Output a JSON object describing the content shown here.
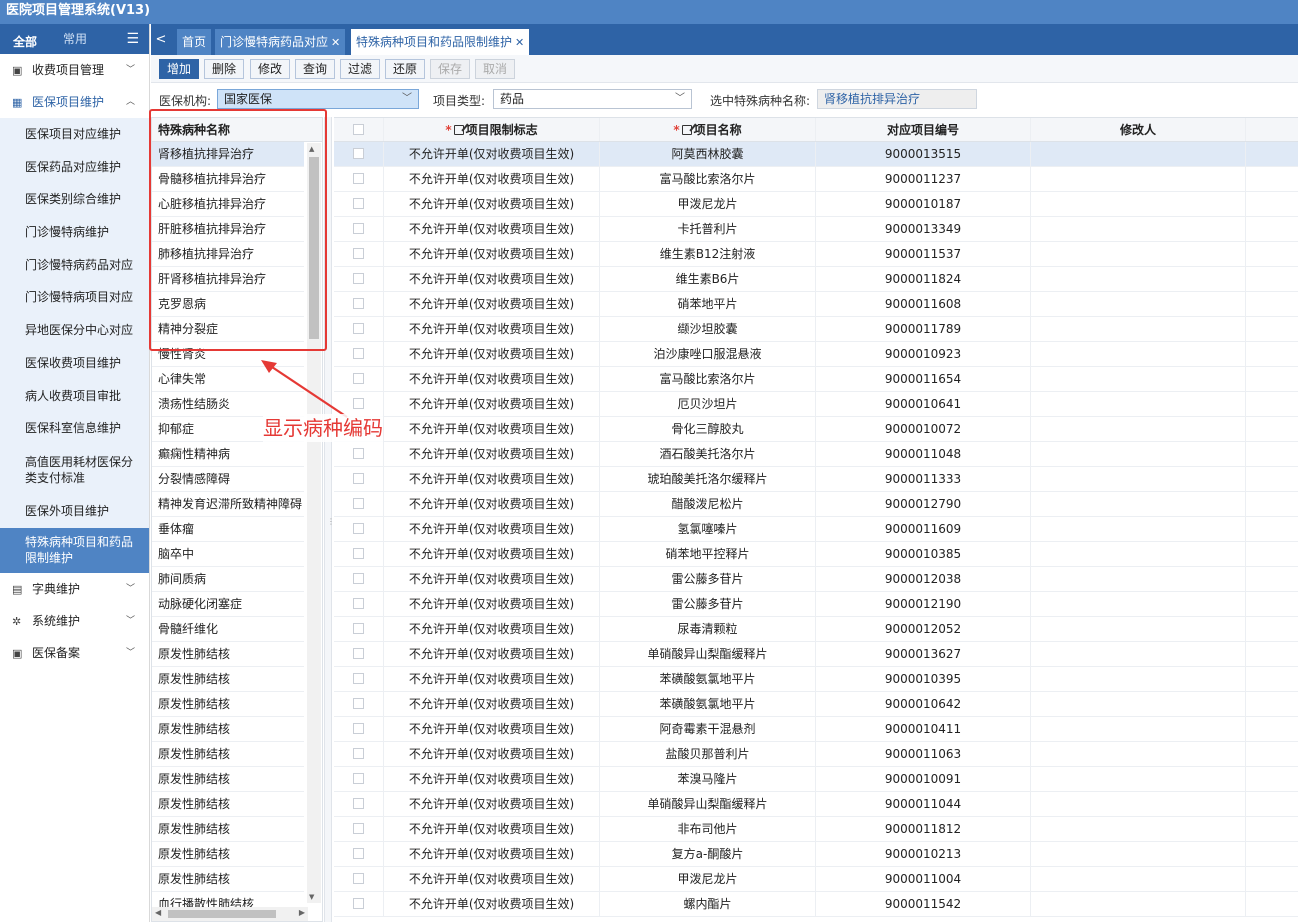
{
  "app": {
    "title": "医院项目管理系统(V13)"
  },
  "nav": {
    "tabs": [
      "全部",
      "常用"
    ],
    "groups": [
      {
        "label": "收费项目管理",
        "icon": "calendar-icon",
        "open": false
      },
      {
        "label": "医保项目维护",
        "icon": "grid-icon",
        "open": true,
        "items": [
          "医保项目对应维护",
          "医保药品对应维护",
          "医保类别综合维护",
          "门诊慢特病维护",
          "门诊慢特病药品对应",
          "门诊慢特病项目对应",
          "异地医保分中心对应",
          "医保收费项目维护",
          "病人收费项目审批",
          "医保科室信息维护",
          "高值医用耗材医保分类支付标准",
          "医保外项目维护",
          "特殊病种项目和药品限制维护"
        ]
      },
      {
        "label": "字典维护",
        "icon": "book-icon",
        "open": false
      },
      {
        "label": "系统维护",
        "icon": "gear-icon",
        "open": false
      },
      {
        "label": "医保备案",
        "icon": "folder-icon",
        "open": false
      }
    ]
  },
  "page_tabs": [
    {
      "label": "首页",
      "closable": false
    },
    {
      "label": "门诊慢特病药品对应",
      "closable": true
    },
    {
      "label": "特殊病种项目和药品限制维护",
      "closable": true
    }
  ],
  "toolbar": {
    "buttons": [
      "增加",
      "删除",
      "修改",
      "查询",
      "过滤",
      "还原",
      "保存",
      "取消"
    ]
  },
  "filters": {
    "org_label": "医保机构:",
    "org_value": "国家医保",
    "type_label": "项目类型:",
    "type_value": "药品",
    "selected_label": "选中特殊病种名称:",
    "selected_value": "肾移植抗排异治疗"
  },
  "disease_list": {
    "header": "特殊病种名称",
    "rows": [
      "肾移植抗排异治疗",
      "骨髓移植抗排异治疗",
      "心脏移植抗排异治疗",
      "肝脏移植抗排异治疗",
      "肺移植抗排异治疗",
      "肝肾移植抗排异治疗",
      "克罗恩病",
      "精神分裂症",
      "慢性肾炎",
      "心律失常",
      "溃疡性结肠炎",
      "抑郁症",
      "癫痫性精神病",
      "分裂情感障碍",
      "精神发育迟滞所致精神障碍",
      "垂体瘤",
      "脑卒中",
      "肺间质病",
      "动脉硬化闭塞症",
      "骨髓纤维化",
      "原发性肺结核",
      "原发性肺结核",
      "原发性肺结核",
      "原发性肺结核",
      "原发性肺结核",
      "原发性肺结核",
      "原发性肺结核",
      "原发性肺结核",
      "原发性肺结核",
      "原发性肺结核",
      "血行播散性肺结核"
    ]
  },
  "grid": {
    "columns": [
      "",
      "项目限制标志",
      "项目名称",
      "对应项目编号",
      "修改人"
    ],
    "rows": [
      [
        "不允许开单(仅对收费项目生效)",
        "阿莫西林胶囊",
        "9000013515"
      ],
      [
        "不允许开单(仅对收费项目生效)",
        "富马酸比索洛尔片",
        "9000011237"
      ],
      [
        "不允许开单(仅对收费项目生效)",
        "甲泼尼龙片",
        "9000010187"
      ],
      [
        "不允许开单(仅对收费项目生效)",
        "卡托普利片",
        "9000013349"
      ],
      [
        "不允许开单(仅对收费项目生效)",
        "维生素B12注射液",
        "9000011537"
      ],
      [
        "不允许开单(仅对收费项目生效)",
        "维生素B6片",
        "9000011824"
      ],
      [
        "不允许开单(仅对收费项目生效)",
        "硝苯地平片",
        "9000011608"
      ],
      [
        "不允许开单(仅对收费项目生效)",
        "缬沙坦胶囊",
        "9000011789"
      ],
      [
        "不允许开单(仅对收费项目生效)",
        "泊沙康唑口服混悬液",
        "9000010923"
      ],
      [
        "不允许开单(仅对收费项目生效)",
        "富马酸比索洛尔片",
        "9000011654"
      ],
      [
        "不允许开单(仅对收费项目生效)",
        "厄贝沙坦片",
        "9000010641"
      ],
      [
        "不允许开单(仅对收费项目生效)",
        "骨化三醇胶丸",
        "9000010072"
      ],
      [
        "不允许开单(仅对收费项目生效)",
        "酒石酸美托洛尔片",
        "9000011048"
      ],
      [
        "不允许开单(仅对收费项目生效)",
        "琥珀酸美托洛尔缓释片",
        "9000011333"
      ],
      [
        "不允许开单(仅对收费项目生效)",
        "醋酸泼尼松片",
        "9000012790"
      ],
      [
        "不允许开单(仅对收费项目生效)",
        "氢氯噻嗪片",
        "9000011609"
      ],
      [
        "不允许开单(仅对收费项目生效)",
        "硝苯地平控释片",
        "9000010385"
      ],
      [
        "不允许开单(仅对收费项目生效)",
        "雷公藤多苷片",
        "9000012038"
      ],
      [
        "不允许开单(仅对收费项目生效)",
        "雷公藤多苷片",
        "9000012190"
      ],
      [
        "不允许开单(仅对收费项目生效)",
        "尿毒清颗粒",
        "9000012052"
      ],
      [
        "不允许开单(仅对收费项目生效)",
        "单硝酸异山梨酯缓释片",
        "9000013627"
      ],
      [
        "不允许开单(仅对收费项目生效)",
        "苯磺酸氨氯地平片",
        "9000010395"
      ],
      [
        "不允许开单(仅对收费项目生效)",
        "苯磺酸氨氯地平片",
        "9000010642"
      ],
      [
        "不允许开单(仅对收费项目生效)",
        "阿奇霉素干混悬剂",
        "9000010411"
      ],
      [
        "不允许开单(仅对收费项目生效)",
        "盐酸贝那普利片",
        "9000011063"
      ],
      [
        "不允许开单(仅对收费项目生效)",
        "苯溴马隆片",
        "9000010091"
      ],
      [
        "不允许开单(仅对收费项目生效)",
        "单硝酸异山梨酯缓释片",
        "9000011044"
      ],
      [
        "不允许开单(仅对收费项目生效)",
        "非布司他片",
        "9000011812"
      ],
      [
        "不允许开单(仅对收费项目生效)",
        "复方a-酮酸片",
        "9000010213"
      ],
      [
        "不允许开单(仅对收费项目生效)",
        "甲泼尼龙片",
        "9000011004"
      ],
      [
        "不允许开单(仅对收费项目生效)",
        "螺内酯片",
        "9000011542"
      ]
    ]
  },
  "annotation": {
    "text": "显示病种编码"
  },
  "colors": {
    "brand": "#2e63a6",
    "accent": "#4f84c4",
    "annotation": "#e53935"
  }
}
